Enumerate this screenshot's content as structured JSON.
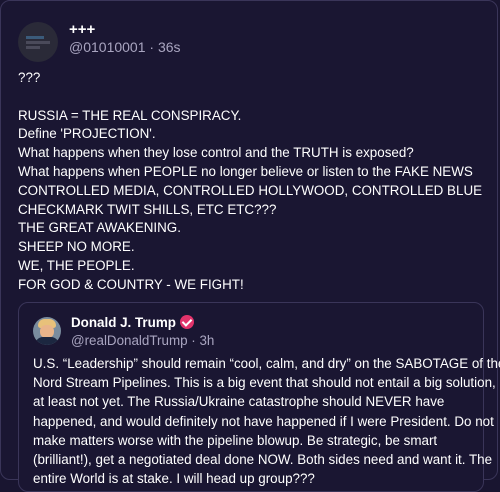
{
  "post": {
    "display_name": "+++",
    "handle": "@01010001",
    "separator": "·",
    "time": "36s",
    "lines": [
      "???",
      "",
      "RUSSIA = THE REAL CONSPIRACY.",
      "Define 'PROJECTION'.",
      "What happens when they lose control and the TRUTH is exposed?",
      "What happens when PEOPLE no longer believe or listen to the FAKE NEWS",
      "CONTROLLED MEDIA, CONTROLLED HOLLYWOOD, CONTROLLED BLUE",
      "CHECKMARK TWIT SHILLS, ETC ETC???",
      "THE GREAT AWAKENING.",
      "SHEEP NO MORE.",
      "WE, THE PEOPLE.",
      "FOR GOD & COUNTRY - WE FIGHT!"
    ]
  },
  "quoted_post": {
    "display_name": "Donald J. Trump",
    "handle": "@realDonaldTrump",
    "separator": "·",
    "time": "3h",
    "lines": [
      "U.S. “Leadership” should remain “cool, calm, and dry” on the SABOTAGE of the",
      "Nord Stream Pipelines. This is a big event that should not entail a big solution,",
      "at least not yet. The Russia/Ukraine catastrophe should NEVER have",
      "happened, and would definitely not have happened if I were President. Do not",
      "make matters worse with the pipeline blowup. Be strategic, be smart",
      "(brilliant!), get a negotiated deal done NOW. Both sides need and want it. The",
      "entire World is at stake. I will head up group???"
    ]
  },
  "colors": {
    "background": "#191530",
    "border": "#3a3559",
    "muted_text": "#a9a5c0",
    "verified_badge": "#e2336b"
  }
}
